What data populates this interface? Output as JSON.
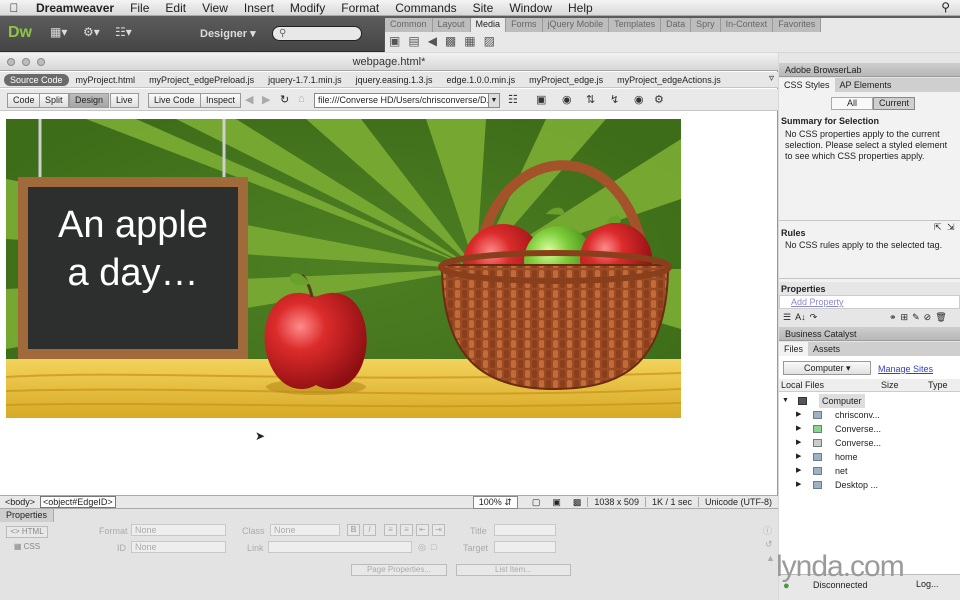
{
  "menubar": {
    "app": "Dreamweaver",
    "items": [
      "File",
      "Edit",
      "View",
      "Insert",
      "Modify",
      "Format",
      "Commands",
      "Site",
      "Window",
      "Help"
    ]
  },
  "appbar": {
    "logo": "Dw",
    "workspace": "Designer",
    "workspace_arrow": "▾"
  },
  "insert_panel": {
    "tabs": [
      "Common",
      "Layout",
      "Media",
      "Forms",
      "jQuery Mobile",
      "Templates",
      "Data",
      "Spry",
      "In-Context",
      "Favorites"
    ],
    "active_tab": "Media"
  },
  "document": {
    "title": "webpage.html*",
    "related_files": [
      "Source Code",
      "myProject.html",
      "myProject_edgePreload.js",
      "jquery-1.7.1.min.js",
      "jquery.easing.1.3.js",
      "edge.1.0.0.min.js",
      "myProject_edge.js",
      "myProject_edgeActions.js"
    ],
    "views": [
      "Code",
      "Split",
      "Design"
    ],
    "active_view": "Design",
    "live": "Live",
    "live_code": "Live Code",
    "inspect": "Inspect",
    "address": "file:///Converse HD/Users/chrisconverse/D..."
  },
  "stage": {
    "headline_line1": "An apple",
    "headline_line2": "a day…",
    "colors": {
      "bg_dark": "#4c7d22",
      "bg_light": "#78aa33",
      "table": "#e8c23c",
      "apple": "#d42a2a",
      "green_apple": "#7ccc3a",
      "basket": "#a3522a"
    }
  },
  "statusbar": {
    "tags": [
      "<body>",
      "<object#EdgeID>"
    ],
    "zoom": "100%",
    "size": "1038 x 509",
    "download": "1K / 1 sec",
    "encoding": "Unicode (UTF-8)"
  },
  "properties": {
    "tab": "Properties",
    "html": "HTML",
    "css": "CSS",
    "format_label": "Format",
    "format_value": "None",
    "class_label": "Class",
    "class_value": "None",
    "id_label": "ID",
    "id_value": "None",
    "link_label": "Link",
    "title_label": "Title",
    "target_label": "Target",
    "page_props": "Page Properties...",
    "list_item": "List Item..."
  },
  "right": {
    "browserlab": "Adobe BrowserLab",
    "tabs": [
      "CSS Styles",
      "AP Elements"
    ],
    "all": "All",
    "current": "Current",
    "summary_title": "Summary for Selection",
    "summary_text": "No CSS properties apply to the current selection.  Please select a styled element to see which CSS properties apply.",
    "rules_title": "Rules",
    "rules_text": "No CSS rules apply to the selected tag.",
    "properties_title": "Properties",
    "add_property": "Add Property",
    "business_catalyst": "Business Catalyst",
    "files_tabs": [
      "Files",
      "Assets"
    ],
    "location": "Computer",
    "manage_sites": "Manage Sites",
    "columns": [
      "Local Files",
      "Size",
      "Type"
    ],
    "files": [
      {
        "name": "Computer",
        "root": true
      },
      {
        "name": "chrisconv..."
      },
      {
        "name": "Converse..."
      },
      {
        "name": "Converse..."
      },
      {
        "name": "home"
      },
      {
        "name": "net"
      },
      {
        "name": "Desktop ..."
      }
    ],
    "connection": "Disconnected",
    "log": "Log..."
  },
  "watermark": "lynda.com"
}
